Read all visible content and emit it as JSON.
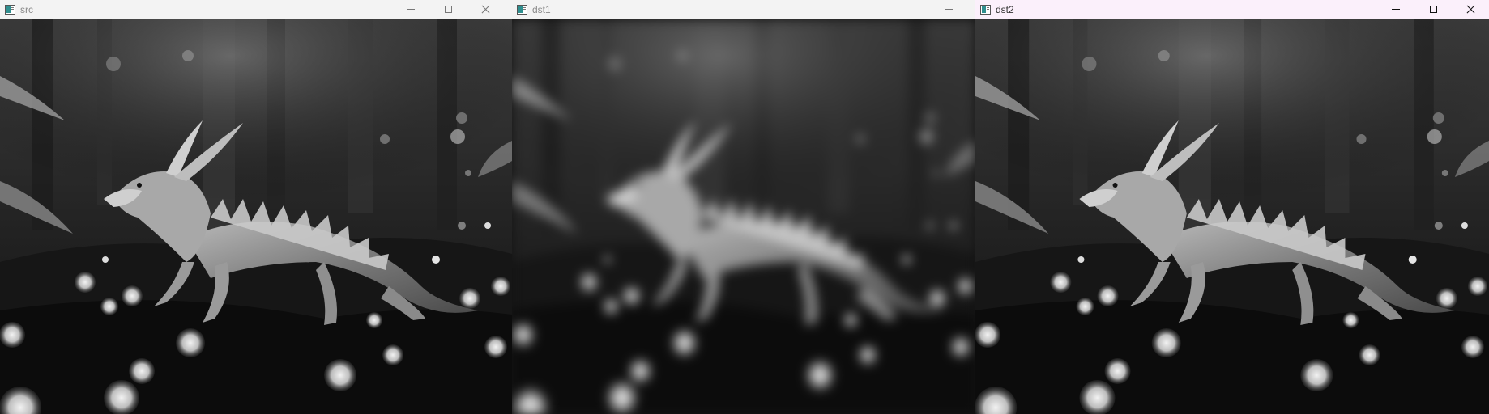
{
  "windows": [
    {
      "title": "src"
    },
    {
      "title": "dst1"
    },
    {
      "title": "dst2"
    }
  ],
  "icons": {
    "app": "window-app-icon",
    "minimize": "minimize-icon",
    "maximize": "maximize-icon",
    "close": "close-icon"
  }
}
